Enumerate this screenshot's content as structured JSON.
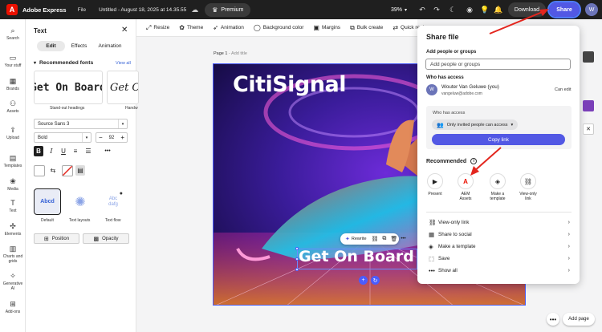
{
  "topbar": {
    "app_name": "Adobe Express",
    "file_menu": "File",
    "doc_title": "Untitled - August 18, 2025 at 14.35.55",
    "premium": "Premium",
    "zoom": "39%",
    "download": "Download",
    "share": "Share",
    "user_initial": "W"
  },
  "rail": [
    {
      "label": "Search",
      "icon": "search-icon"
    },
    {
      "label": "Your stuff",
      "icon": "folder-icon"
    },
    {
      "label": "Brands",
      "icon": "brand-icon"
    },
    {
      "label": "Assets",
      "icon": "assets-icon"
    },
    {
      "label": "Upload",
      "icon": "upload-icon"
    },
    {
      "label": "Templates",
      "icon": "templates-icon"
    },
    {
      "label": "Media",
      "icon": "media-icon"
    },
    {
      "label": "Text",
      "icon": "text-icon"
    },
    {
      "label": "Elements",
      "icon": "elements-icon"
    },
    {
      "label": "Charts and grids",
      "icon": "charts-icon"
    },
    {
      "label": "Generative AI",
      "icon": "generative-ai-icon"
    },
    {
      "label": "Add-ons",
      "icon": "addons-icon"
    }
  ],
  "panel": {
    "title": "Text",
    "tabs": [
      "Edit",
      "Effects",
      "Animation"
    ],
    "recommended_heading": "Recommended fonts",
    "view_all": "View all",
    "font_cards": [
      {
        "sample": "Get On Board",
        "caption": "Stand-out headings"
      },
      {
        "sample": "Get On",
        "caption": "Handw"
      }
    ],
    "font_family": "Source Sans 3",
    "font_weight": "Bold",
    "font_size": "92",
    "styles": [
      {
        "sample": "Abcd",
        "caption": "Default"
      },
      {
        "sample": "",
        "caption": "Text layouts"
      },
      {
        "sample": "Abc dafg",
        "caption": "Text flow"
      }
    ],
    "position": "Position",
    "opacity": "Opacity"
  },
  "toolbar": {
    "items": [
      "Resize",
      "Theme",
      "Animation",
      "Background color",
      "Margins",
      "Bulk create",
      "Quick replace"
    ]
  },
  "canvas": {
    "page_label": "Page 1",
    "add_title": "Add title",
    "brand_text": "CitiSignal",
    "board_text": "Get On Board Now",
    "rewrite": "Rewrite"
  },
  "share_panel": {
    "title": "Share file",
    "add_people_label": "Add people or groups",
    "add_people_placeholder": "Add people or groups",
    "who_has_access": "Who has access",
    "user_name": "Wouter Van Geluwe (you)",
    "user_email": "vangeluw@adobe.com",
    "can_edit": "Can edit",
    "box_label": "Who has access",
    "access_option": "Only invited people can access",
    "copy_link": "Copy link",
    "recommended": "Recommended",
    "rec_items": [
      {
        "label": "Present",
        "icon": "present-icon"
      },
      {
        "label": "AEM Assets",
        "icon": "adobe-icon"
      },
      {
        "label": "Make a template",
        "icon": "template-icon"
      },
      {
        "label": "View-only link",
        "icon": "link-icon"
      }
    ],
    "rows": [
      {
        "label": "View-only link",
        "icon": "link-icon"
      },
      {
        "label": "Share to social",
        "icon": "social-icon"
      },
      {
        "label": "Make a template",
        "icon": "template-icon"
      },
      {
        "label": "Save",
        "icon": "save-icon"
      },
      {
        "label": "Show all",
        "icon": "show-all-icon"
      }
    ]
  },
  "bottom": {
    "add_page": "Add page"
  },
  "colors": {
    "accent": "#5258e4",
    "topbar": "#1f1f1f",
    "arrow": "#e3261e"
  }
}
